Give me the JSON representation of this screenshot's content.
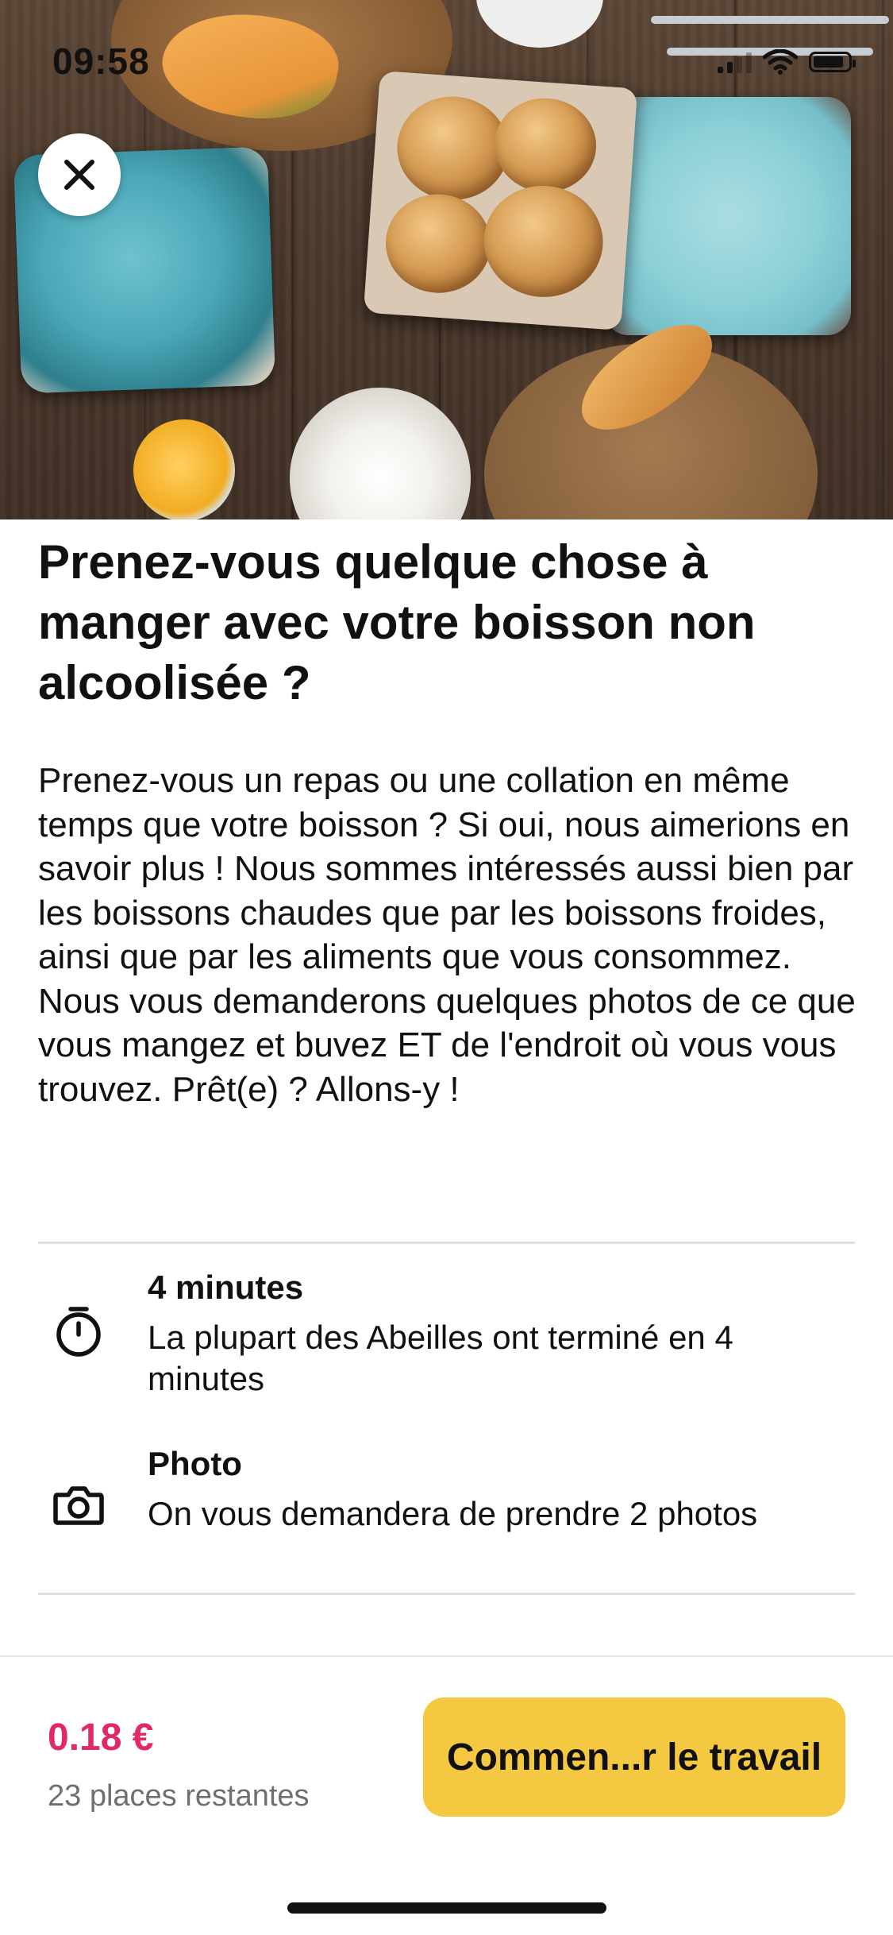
{
  "status_bar": {
    "time": "09:58"
  },
  "hero": {
    "image": "breakfast-table-photo"
  },
  "survey": {
    "title": "Prenez-vous quelque chose à manger avec votre boisson non alcoolisée ?",
    "description": "Prenez-vous un repas ou une collation en même temps que votre boisson ? Si oui, nous aimerions en savoir plus ! Nous sommes intéressés aussi bien par les boissons chaudes que par les boissons froides, ainsi que par les aliments que vous consommez. Nous vous demanderons quelques photos de ce que vous mangez et buvez ET de l'endroit où vous vous trouvez. Prêt(e) ? Allons-y !"
  },
  "info": [
    {
      "icon": "stopwatch-icon",
      "title": "4 minutes",
      "text": "La plupart des Abeilles ont terminé en 4 minutes"
    },
    {
      "icon": "camera-icon",
      "title": "Photo",
      "text": "On vous demandera de prendre 2 photos"
    }
  ],
  "footer": {
    "price": "0.18 €",
    "places": "23 places restantes",
    "start_label": "Commen...r le travail"
  },
  "colors": {
    "accent_price": "#e0286a",
    "button_yellow": "#f5c842"
  }
}
